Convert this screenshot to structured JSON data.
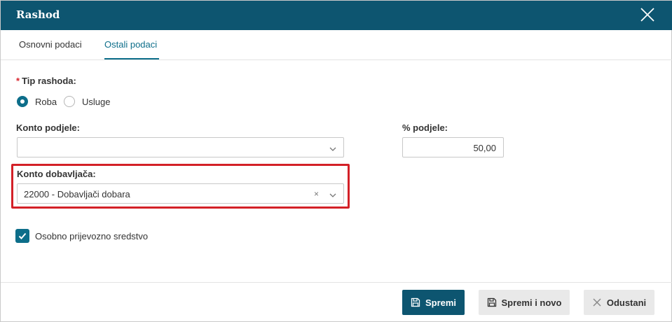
{
  "dialog": {
    "title": "Rashod"
  },
  "tabs": [
    {
      "label": "Osnovni podaci",
      "active": false
    },
    {
      "label": "Ostali podaci",
      "active": true
    }
  ],
  "form": {
    "tip_rashoda": {
      "required_mark": "*",
      "label": "Tip rashoda:",
      "options": [
        {
          "label": "Roba",
          "selected": true
        },
        {
          "label": "Usluge",
          "selected": false
        }
      ]
    },
    "konto_podjele": {
      "label": "Konto podjele:",
      "value": ""
    },
    "postotak_podjele": {
      "label": "% podjele:",
      "value": "50,00"
    },
    "konto_dobavljaca": {
      "label": "Konto dobavljača:",
      "value": "22000 - Dobavljači dobara",
      "clear_glyph": "×"
    },
    "osobno_prijevozno_sredstvo": {
      "label": "Osobno prijevozno sredstvo",
      "checked": true
    }
  },
  "footer": {
    "save_label": "Spremi",
    "save_new_label": "Spremi i novo",
    "cancel_label": "Odustani"
  },
  "colors": {
    "header_bg": "#0d5570",
    "accent": "#0d6e8a",
    "highlight_border": "#d32027",
    "required": "#d9232d"
  }
}
